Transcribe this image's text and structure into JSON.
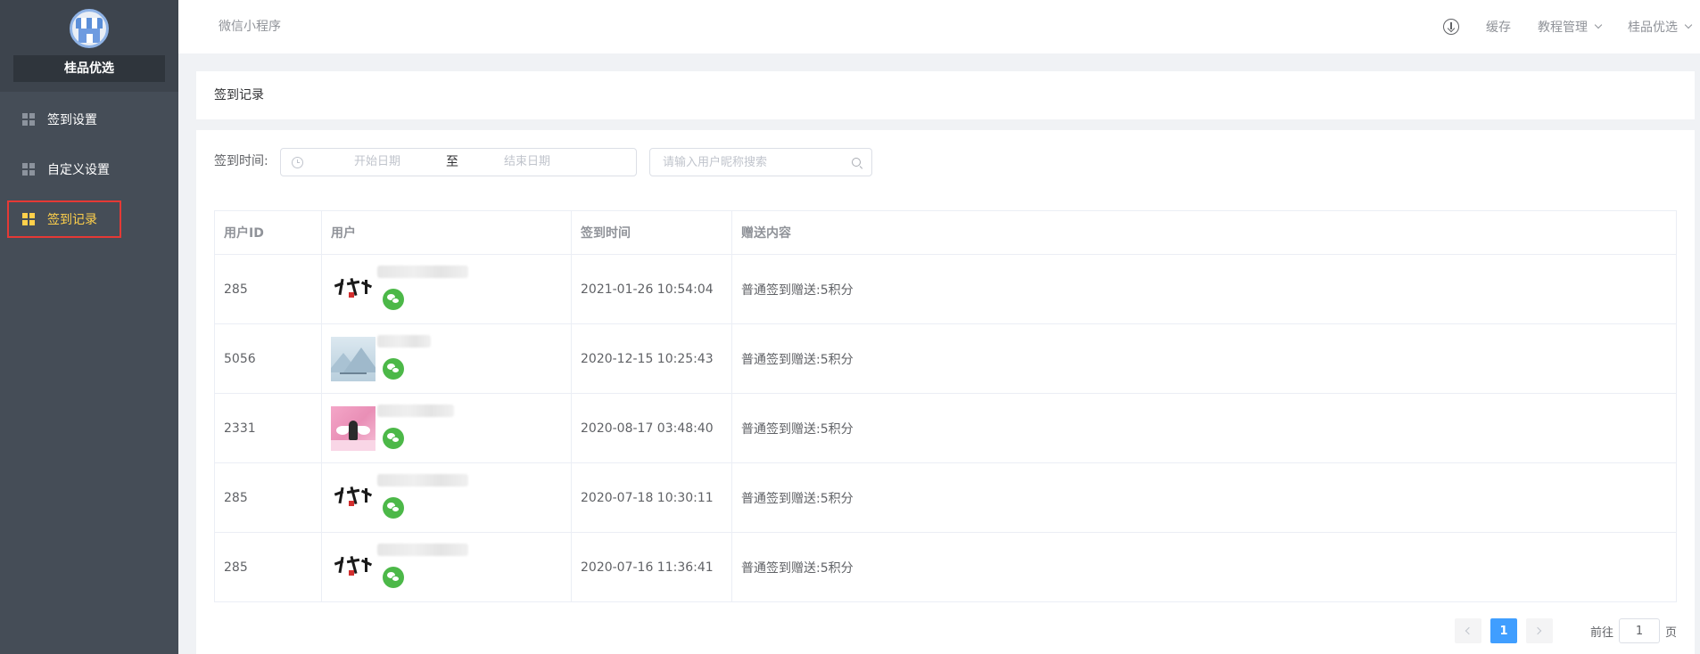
{
  "sidebar": {
    "brand_name": "桂品优选",
    "items": [
      {
        "label": "签到设置",
        "active": false
      },
      {
        "label": "自定义设置",
        "active": false
      },
      {
        "label": "签到记录",
        "active": true
      }
    ]
  },
  "header": {
    "app_name": "微信小程序",
    "icons": [
      "download-icon"
    ],
    "links": [
      {
        "label": "缓存",
        "dropdown": false
      },
      {
        "label": "教程管理",
        "dropdown": true
      },
      {
        "label": "桂品优选",
        "dropdown": true
      }
    ]
  },
  "page": {
    "title": "签到记录"
  },
  "filter": {
    "label": "签到时间:",
    "start_placeholder": "开始日期",
    "separator": "至",
    "end_placeholder": "结束日期",
    "search_placeholder": "请输入用户昵称搜索"
  },
  "table": {
    "columns": [
      "用户ID",
      "用户",
      "签到时间",
      "赠送内容"
    ],
    "rows": [
      {
        "id": "285",
        "avatar": "calligraphy",
        "time": "2021-01-26 10:54:04",
        "content": "普通签到赠送:5积分"
      },
      {
        "id": "5056",
        "avatar": "landscape",
        "time": "2020-12-15 10:25:43",
        "content": "普通签到赠送:5积分"
      },
      {
        "id": "2331",
        "avatar": "pink-figure",
        "time": "2020-08-17 03:48:40",
        "content": "普通签到赠送:5积分"
      },
      {
        "id": "285",
        "avatar": "calligraphy",
        "time": "2020-07-18 10:30:11",
        "content": "普通签到赠送:5积分"
      },
      {
        "id": "285",
        "avatar": "calligraphy",
        "time": "2020-07-16 11:36:41",
        "content": "普通签到赠送:5积分"
      }
    ]
  },
  "pagination": {
    "current_page": "1",
    "jump_label": "前往",
    "jump_value": "1",
    "jump_suffix": "页"
  },
  "colors": {
    "sidebar_bg": "#454d57",
    "active_text": "#ffd04b",
    "active_outline": "#e53935",
    "primary": "#409eff",
    "wechat_green": "#4cb848"
  }
}
